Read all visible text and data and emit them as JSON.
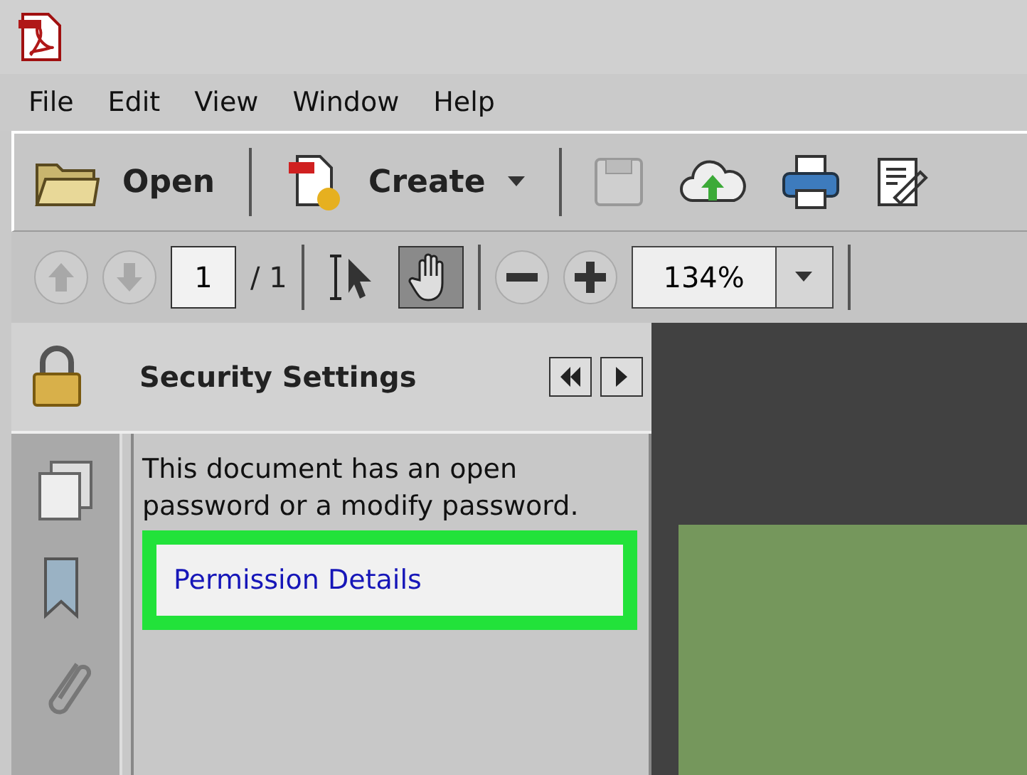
{
  "menu": [
    "File",
    "Edit",
    "View",
    "Window",
    "Help"
  ],
  "toolbar": {
    "open": "Open",
    "create": "Create"
  },
  "nav": {
    "page": "1",
    "total": "/ 1",
    "zoom": "134%",
    "tools": [
      {
        "kind": "select",
        "selected": false
      },
      {
        "kind": "hand",
        "selected": true
      }
    ]
  },
  "panel": {
    "title": "Security Settings",
    "message": "This document has an open password or a modify password.",
    "link": "Permission Details",
    "link_highlighted": true
  }
}
